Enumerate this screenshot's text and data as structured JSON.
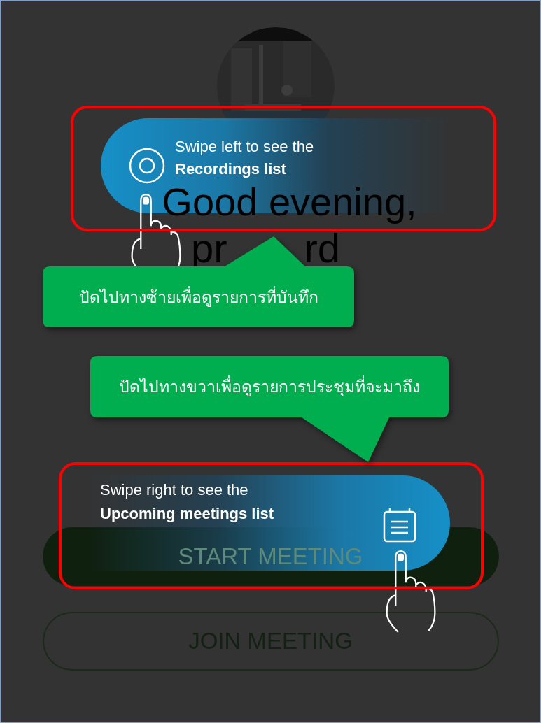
{
  "greeting": "Good evening,",
  "name_fragments": [
    "pr",
    "rd"
  ],
  "buttons": [
    {
      "label": "START MEETING",
      "kind": "filled"
    },
    {
      "label": "JOIN MEETING",
      "kind": "outline"
    }
  ],
  "coach_marks": [
    {
      "kind": "recordings",
      "line1": "Swipe left to see the",
      "line2": "Recordings list"
    },
    {
      "kind": "meetings",
      "line1": "Swipe right to see the",
      "line2": "Upcoming meetings list"
    }
  ],
  "callouts": [
    {
      "text": "ปัดไปทางซ้ายเพื่อดูรายการที่บันทึก"
    },
    {
      "text": "ปัดไปทางขวาเพื่อดูรายการประชุมที่จะมาถึง"
    }
  ]
}
